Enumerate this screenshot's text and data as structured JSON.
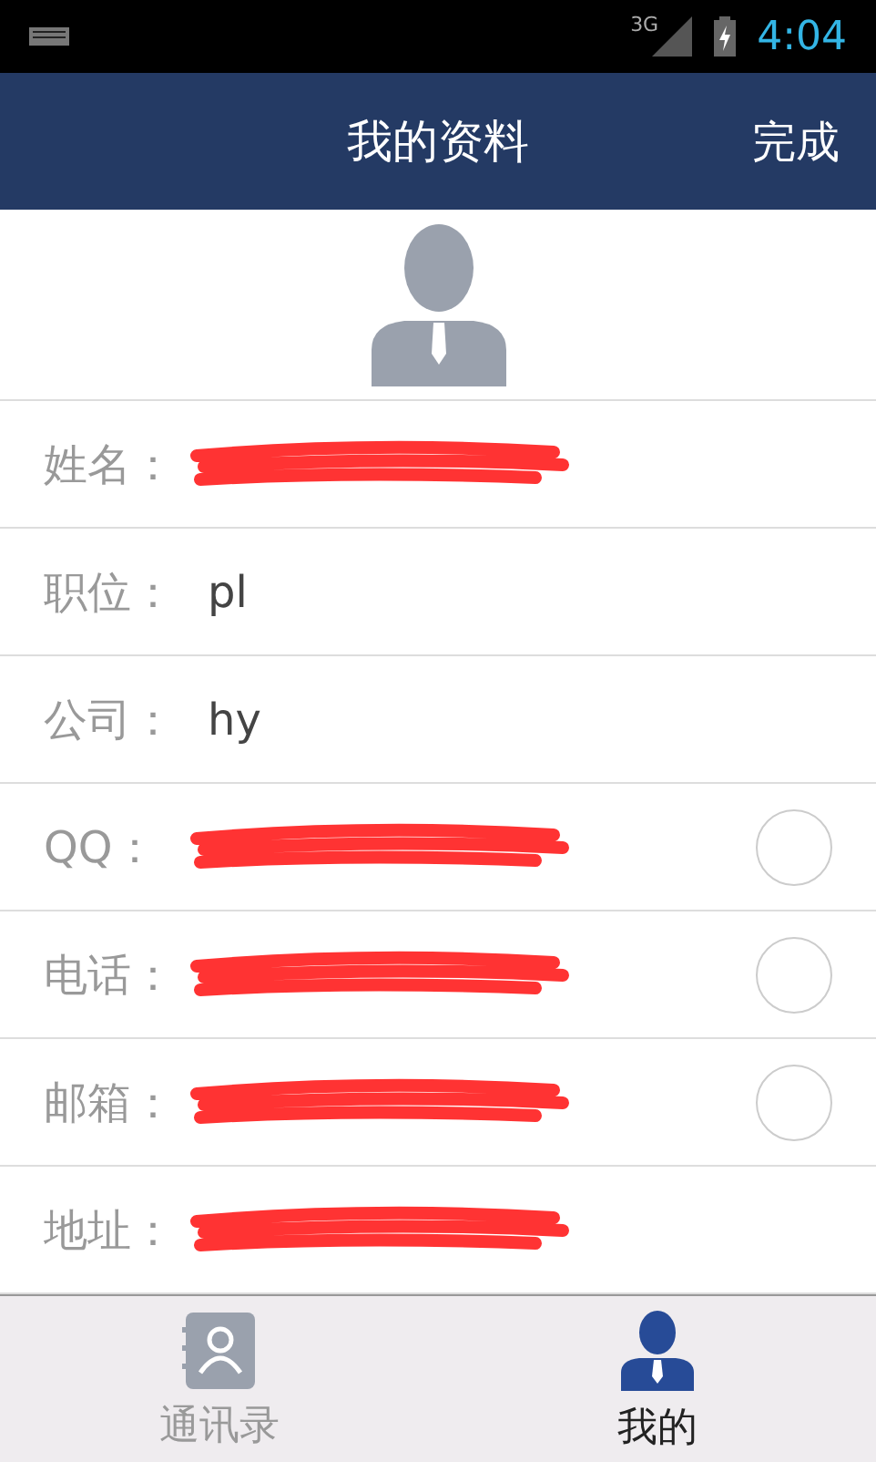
{
  "status_bar": {
    "network": "3G",
    "time": "4:04"
  },
  "header": {
    "title": "我的资料",
    "action": "完成"
  },
  "fields": [
    {
      "label": "姓名：",
      "redacted": true
    },
    {
      "label": "职位：",
      "value": "pl",
      "redacted": false
    },
    {
      "label": "公司：",
      "value": "hy",
      "redacted": false
    },
    {
      "label": "QQ：",
      "redacted": true,
      "checked": false
    },
    {
      "label": "电话：",
      "redacted": true,
      "checked": false
    },
    {
      "label": "邮箱：",
      "redacted": true,
      "checked": false
    },
    {
      "label": "地址：",
      "redacted": true
    }
  ],
  "tabs": [
    {
      "label": "通讯录",
      "kind": "contacts",
      "selected": false
    },
    {
      "label": "我的",
      "kind": "me",
      "selected": true
    }
  ]
}
